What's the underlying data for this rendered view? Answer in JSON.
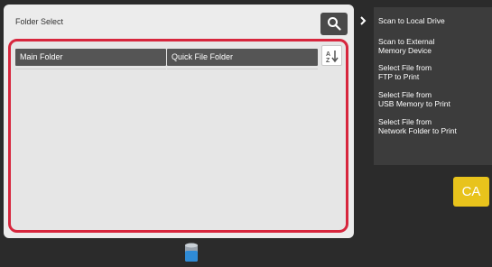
{
  "panel": {
    "title": "Folder Select",
    "columns": [
      "Main Folder",
      "Quick File Folder"
    ]
  },
  "side_menu": {
    "items": [
      "Scan to Local Drive",
      "Scan to External\nMemory Device",
      "Select File from\nFTP to Print",
      "Select File from\nUSB Memory to Print",
      "Select File from\nNetwork Folder to Print"
    ]
  },
  "buttons": {
    "ca_label": "CA"
  },
  "icons": {
    "search": "search-icon",
    "sort": "sort-az-icon",
    "collapse": "chevron-right-icon",
    "storage": "storage-icon"
  },
  "colors": {
    "highlight_frame": "#d7263d",
    "ca_button": "#e8c31c",
    "menu_bg": "#3c3c3c"
  }
}
